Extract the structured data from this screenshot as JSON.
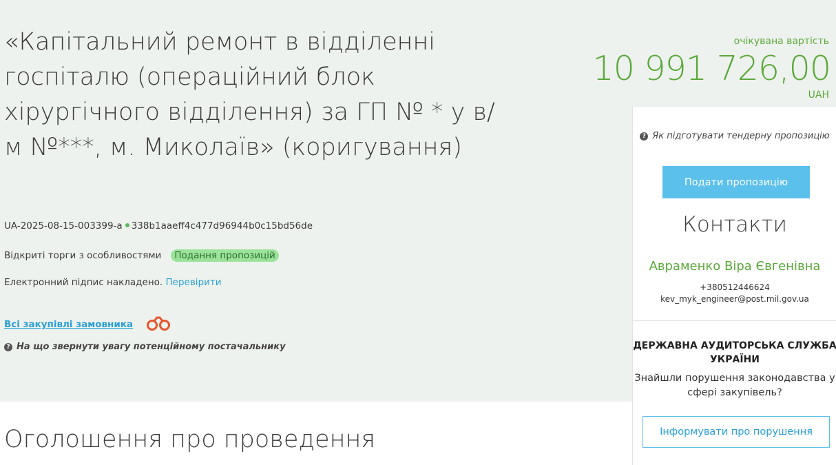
{
  "tender": {
    "title": "«Капітальний ремонт в відділенні госпіталю (операційний блок хірургічного відділення) за ГП № * у в/м №***, м. Миколаїв» (коригування)",
    "id": "UA-2025-08-15-003399-a",
    "hash": "338b1aaeff4c477d96944b0c15bd56de",
    "procedure_type": "Відкриті торги з особливостями",
    "status": "Подання пропозицій",
    "signature_text": "Електронний підпис накладено.",
    "signature_link": "Перевірити",
    "buyer_link": "Всі закупівлі замовника",
    "hint": "На що звернути увагу потенційному постачальнику"
  },
  "price": {
    "label": "очікувана вартість",
    "value": "10 991 726,00",
    "currency": "UAH"
  },
  "sidebar": {
    "how_to": "Як підготувати тендерну пропозицію",
    "submit_button": "Подати пропозицію",
    "contacts_title": "Контакти",
    "contact_name": "Авраменко Віра Євгенівна",
    "contact_phone": "+380512446624",
    "contact_email": "kev_myk_engineer@post.mil.gov.ua",
    "audit_title": "ДЕРЖАВНА АУДИТОРСЬКА СЛУЖБА УКРАЇНИ",
    "audit_text": "Знайшли порушення законодавства у сфері закупівель?",
    "report_button": "Інформувати про порушення"
  },
  "section": {
    "heading": "Оголошення про проведення"
  },
  "colors": {
    "accent_green": "#5aa83a",
    "link_blue": "#2a9fd6",
    "button_blue": "#5bc0eb",
    "badge_green": "#9be39a",
    "hero_bg": "#eef2ee"
  }
}
